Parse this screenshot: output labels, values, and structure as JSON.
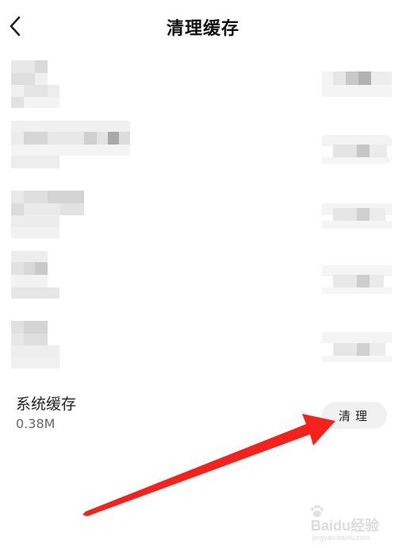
{
  "header": {
    "title": "清理缓存",
    "back_icon": "chevron-left-icon"
  },
  "system_cache": {
    "name": "系统缓存",
    "size": "0.38M",
    "clear_label": "清理"
  },
  "annotation": {
    "arrow_color": "#f5221b"
  },
  "watermark": {
    "brand": "Baidu经验",
    "url": "jingyan.baidu.com"
  }
}
